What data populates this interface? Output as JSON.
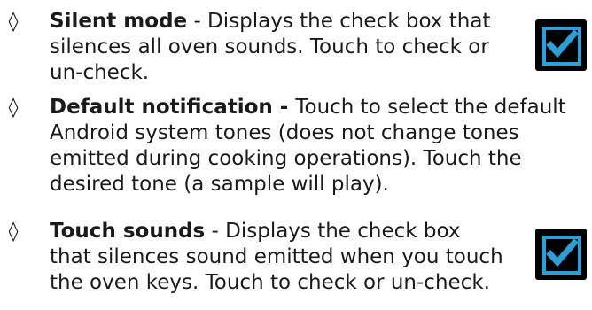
{
  "items": [
    {
      "bullet": "◊",
      "title": "Silent mode",
      "lines": [
        " - Displays the check box that",
        "silences all oven sounds. Touch to check or",
        "un-check."
      ],
      "has_checkbox_icon": true
    },
    {
      "bullet": "◊",
      "title": "Default notification - ",
      "lines": [
        "Touch to select the default",
        "Android system tones (does not change tones",
        "emitted during cooking operations). Touch the",
        "desired tone (a sample will play)."
      ],
      "has_checkbox_icon": false
    },
    {
      "bullet": "◊",
      "title": "Touch sounds",
      "lines": [
        " - Displays the check box",
        "that silences sound emitted when you touch",
        "the oven keys. Touch to check or un-check."
      ],
      "has_checkbox_icon": true
    }
  ],
  "colors": {
    "text": "#1a1a1a",
    "checkbox_background": "#000000",
    "checkbox_accent": "#2d9fd6",
    "checkmark": "#2d9fd6"
  },
  "icons": [
    "checked-checkbox-icon",
    "checked-checkbox-icon"
  ]
}
